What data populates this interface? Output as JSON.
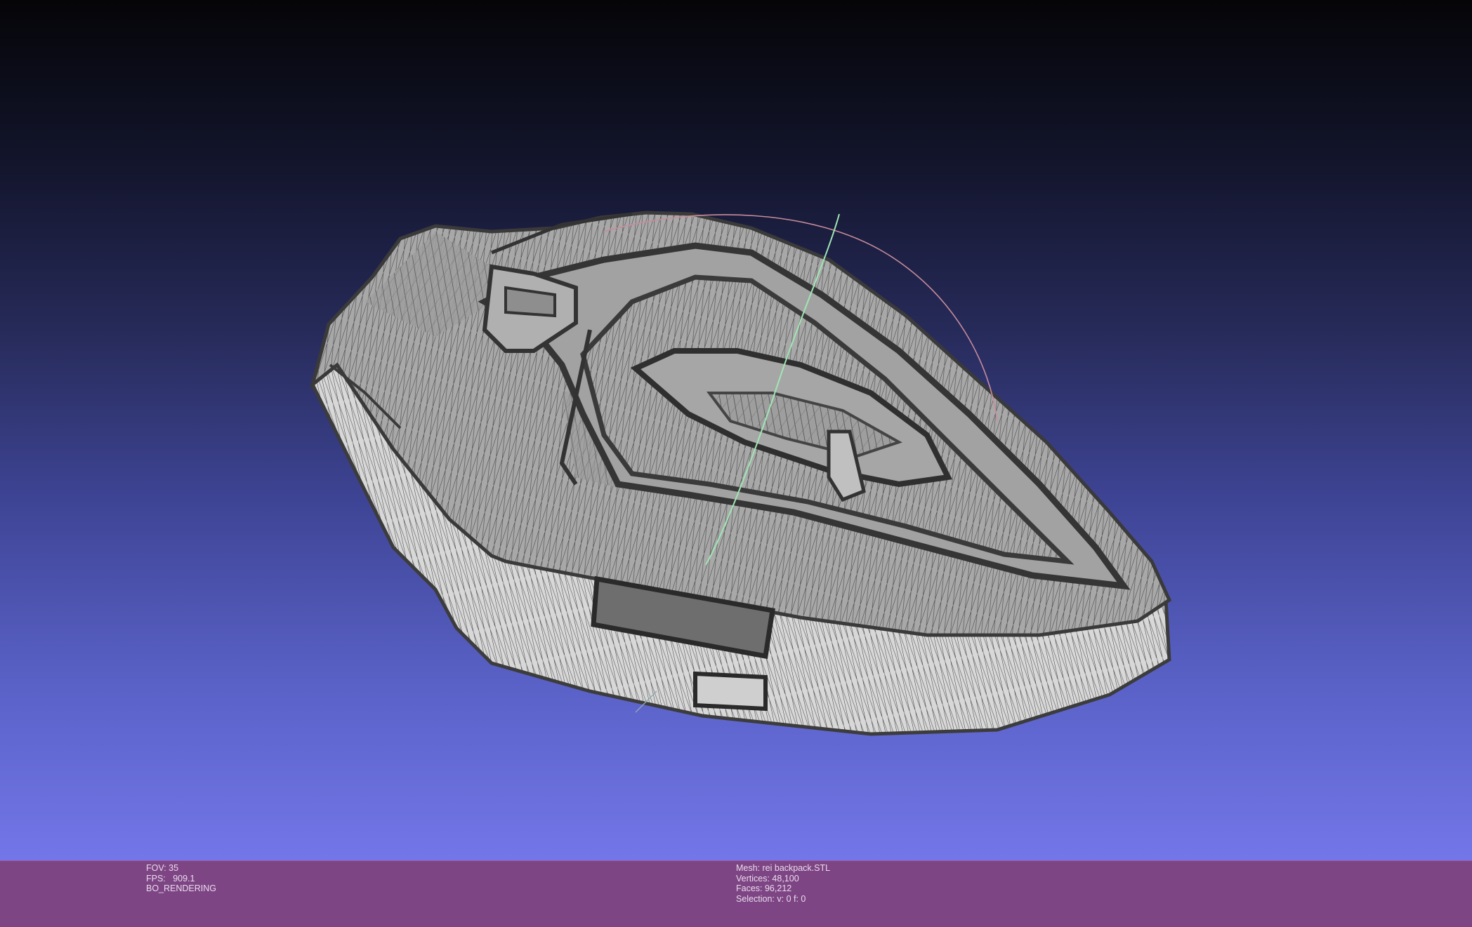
{
  "viewer": {
    "fov_line": "FOV: 35",
    "fps_line": "FPS:   909.1",
    "mode_line": "BO_RENDERING"
  },
  "mesh_info": {
    "mesh_line": "Mesh: rei backpack.STL",
    "vertices_line": "Vertices: 48,100",
    "faces_line": "Faces: 96,212",
    "selection_line": "Selection: v: 0 f: 0"
  },
  "colors": {
    "background_top": "#050508",
    "background_bottom": "#7376e8",
    "info_bar": "#7e4585",
    "mesh_face": "#a4a4a4",
    "mesh_edge": "#3c3c3c",
    "trackball_red": "#c88c9c",
    "trackball_green": "#a0e6b4"
  },
  "icons": {
    "trackball_red_ring": "trackball-x-arc",
    "trackball_green_ring": "trackball-y-arc"
  }
}
